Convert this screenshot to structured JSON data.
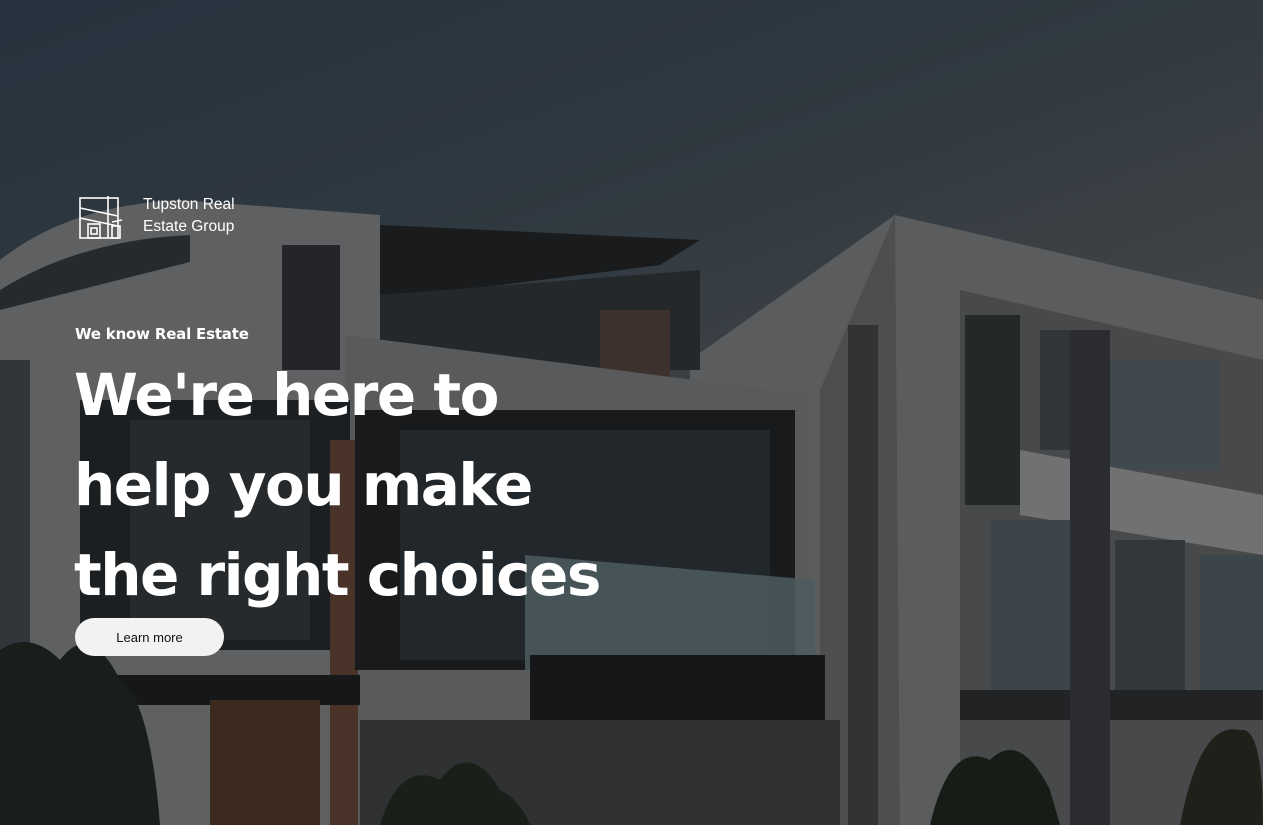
{
  "brand": {
    "name": "Tupston Real Estate Group",
    "logo_icon": "building-outline-icon"
  },
  "hero": {
    "eyebrow": "We know Real Estate",
    "headline": "We're here to help you make the right choices",
    "cta_label": "Learn more",
    "background_image": "modern-apartment-buildings-photo"
  },
  "colors": {
    "text": "#ffffff",
    "button_bg": "#f2f2f2",
    "button_text": "#111111"
  }
}
